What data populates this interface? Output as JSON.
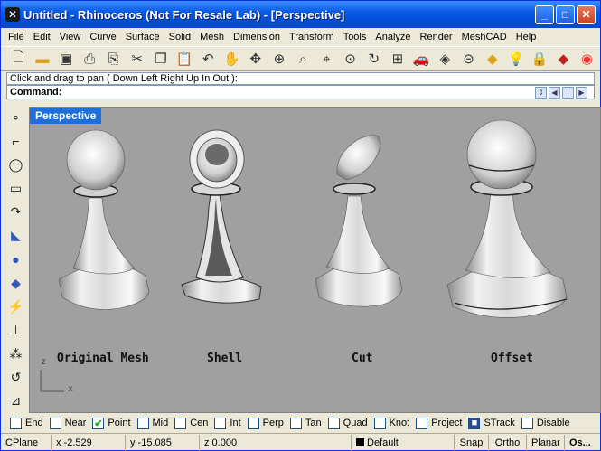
{
  "window": {
    "title": "Untitled - Rhinoceros (Not For Resale Lab) - [Perspective]"
  },
  "menu": [
    "File",
    "Edit",
    "View",
    "Curve",
    "Surface",
    "Solid",
    "Mesh",
    "Dimension",
    "Transform",
    "Tools",
    "Analyze",
    "Render",
    "MeshCAD",
    "Help"
  ],
  "toolbar_icons": [
    "new-file",
    "open-folder",
    "save",
    "print",
    "import",
    "cut",
    "copy",
    "paste",
    "undo",
    "pan-hand",
    "rotate-view",
    "zoom",
    "zoom-window",
    "zoom-extents",
    "zoom-selected",
    "rotate-3d",
    "four-viewports",
    "car-render",
    "render-surface",
    "osnap",
    "layer",
    "light-bulb",
    "lock",
    "materials",
    "color-wheel"
  ],
  "command": {
    "history": "Click and drag to pan ( Down  Left  Right  Up  In  Out ):",
    "prompt": "Command:"
  },
  "viewport": {
    "name": "Perspective",
    "labels": [
      "Original Mesh",
      "Shell",
      "Cut",
      "Offset"
    ],
    "axis_y": "z",
    "axis_x": "x"
  },
  "left_toolbar_icons": [
    "point",
    "polyline",
    "circle",
    "rectangle",
    "curve",
    "surface",
    "solid-sphere",
    "mesh",
    "transform",
    "dimension",
    "array",
    "osnap-curve",
    "grid"
  ],
  "snaps": [
    {
      "label": "End",
      "checked": false
    },
    {
      "label": "Near",
      "checked": false
    },
    {
      "label": "Point",
      "checked": true
    },
    {
      "label": "Mid",
      "checked": false
    },
    {
      "label": "Cen",
      "checked": false
    },
    {
      "label": "Int",
      "checked": false
    },
    {
      "label": "Perp",
      "checked": false
    },
    {
      "label": "Tan",
      "checked": false
    },
    {
      "label": "Quad",
      "checked": false
    },
    {
      "label": "Knot",
      "checked": false
    },
    {
      "label": "Project",
      "checked": false
    },
    {
      "label": "STrack",
      "checked": true
    },
    {
      "label": "Disable",
      "checked": false
    }
  ],
  "status": {
    "cplane": "CPlane",
    "x": "x -2.529",
    "y": "y -15.085",
    "z": "z 0.000",
    "layer": "Default",
    "snap": "Snap",
    "ortho": "Ortho",
    "planar": "Planar",
    "osnap": "Os..."
  }
}
